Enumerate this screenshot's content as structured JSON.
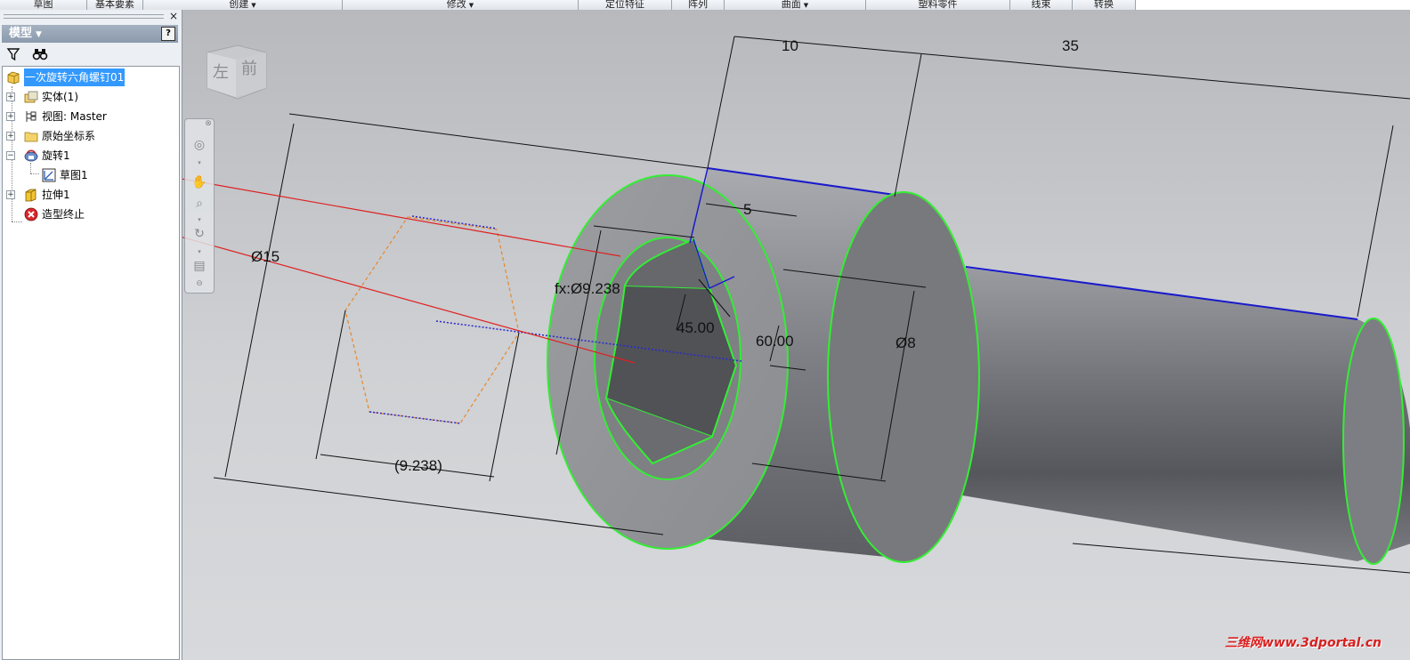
{
  "ribbon": {
    "groups": [
      {
        "label": "草图",
        "has_dropdown": false
      },
      {
        "label": "基本要素",
        "has_dropdown": false
      },
      {
        "label": "创建",
        "has_dropdown": true
      },
      {
        "label": "修改",
        "has_dropdown": true
      },
      {
        "label": "定位特征",
        "has_dropdown": false
      },
      {
        "label": "阵列",
        "has_dropdown": false
      },
      {
        "label": "曲面",
        "has_dropdown": true
      },
      {
        "label": "塑料零件",
        "has_dropdown": false
      },
      {
        "label": "线束",
        "has_dropdown": false
      },
      {
        "label": "转换",
        "has_dropdown": false
      }
    ]
  },
  "browser": {
    "title": "模型",
    "help_label": "?",
    "close_label": "×",
    "tree": [
      {
        "label": "一次旋转六角螺钉01",
        "icon": "part-icon",
        "selected": true
      },
      {
        "label": "实体(1)",
        "icon": "solid-bodies-icon",
        "expander": "+"
      },
      {
        "label": "视图: Master",
        "icon": "view-rep-icon",
        "expander": "+"
      },
      {
        "label": "原始坐标系",
        "icon": "origin-folder-icon",
        "expander": "+"
      },
      {
        "label": "旋转1",
        "icon": "revolve-feature-icon",
        "expander": "−"
      },
      {
        "label": "草图1",
        "icon": "sketch-icon"
      },
      {
        "label": "拉伸1",
        "icon": "extrude-feature-icon",
        "expander": "+"
      },
      {
        "label": "造型终止",
        "icon": "end-of-part-icon"
      }
    ]
  },
  "viewport": {
    "viewcube": {
      "face_left": "左",
      "face_front": "前"
    },
    "dimensions": {
      "d10": "10",
      "d35": "35",
      "d5": "5",
      "d15": "Ø15",
      "d9238": "fx:Ø9.238",
      "d45": "45.00",
      "d60": "60.00",
      "d8": "Ø8",
      "d9238_ref": "(9.238)"
    },
    "colors": {
      "edge_highlight": "#33ee33",
      "edge_blue": "#1a1acc",
      "arrow_red": "#e02020",
      "sketch_orange": "#e8872a"
    },
    "watermark": "三维网www.3dportal.cn"
  }
}
